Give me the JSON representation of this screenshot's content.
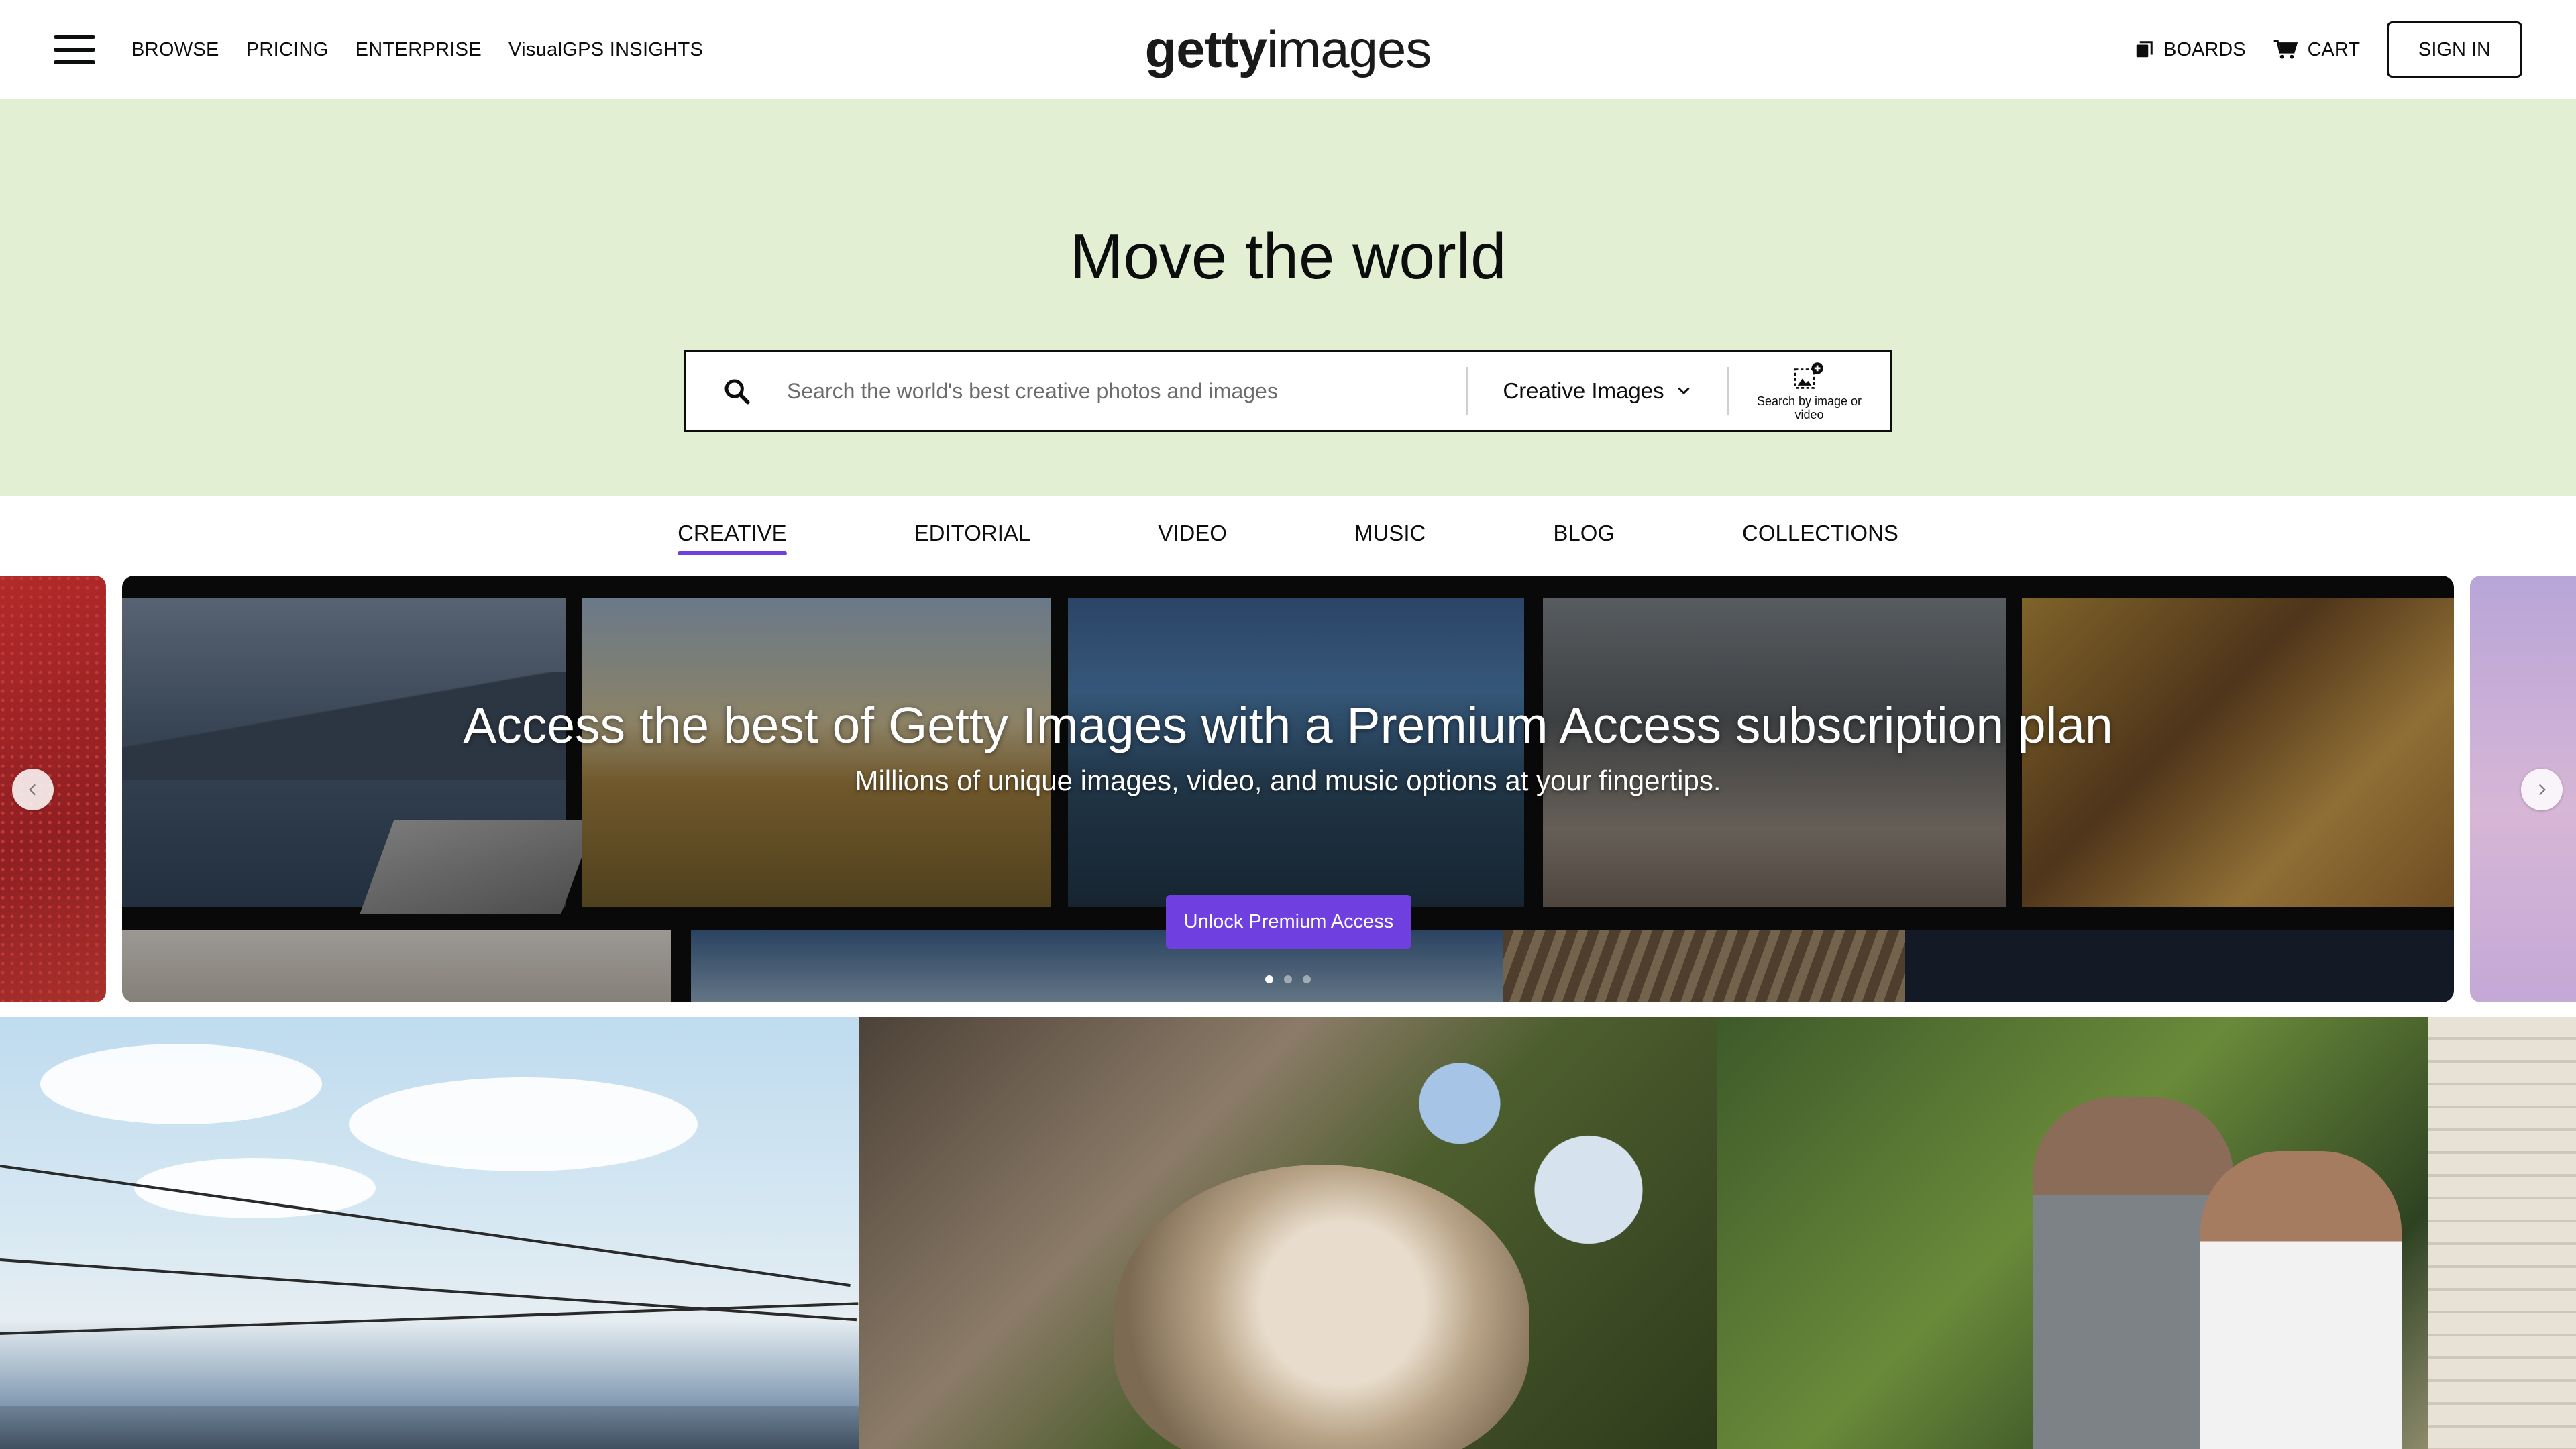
{
  "header": {
    "menu_icon": "hamburger-menu-icon",
    "nav": [
      "BROWSE",
      "PRICING",
      "ENTERPRISE",
      "VisualGPS INSIGHTS"
    ],
    "logo_bold": "getty",
    "logo_light": "images",
    "boards_label": "BOARDS",
    "boards_icon": "boards-icon",
    "cart_label": "CART",
    "cart_icon": "cart-icon",
    "signin_label": "SIGN IN"
  },
  "hero": {
    "title": "Move the world",
    "background_color": "#e3efd3",
    "search": {
      "icon": "search-icon",
      "placeholder": "Search the world's best creative photos and images",
      "value": "",
      "type_selected": "Creative Images",
      "visual_search_icon": "image-search-icon",
      "visual_search_label": "Search by image or video"
    }
  },
  "tabs": [
    {
      "label": "CREATIVE",
      "active": true
    },
    {
      "label": "EDITORIAL",
      "active": false
    },
    {
      "label": "VIDEO",
      "active": false
    },
    {
      "label": "MUSIC",
      "active": false
    },
    {
      "label": "BLOG",
      "active": false
    },
    {
      "label": "COLLECTIONS",
      "active": false
    }
  ],
  "carousel": {
    "title": "Access the best of Getty Images with a Premium Access subscription plan",
    "subtitle": "Millions of unique images, video, and music options at your fingertips.",
    "cta_label": "Unlock Premium Access",
    "cta_color": "#6f3fe0",
    "dots": 3,
    "active_dot": 0,
    "prev_icon": "chevron-left-icon",
    "next_icon": "chevron-right-icon"
  },
  "accent_color": "#6f3fe0"
}
